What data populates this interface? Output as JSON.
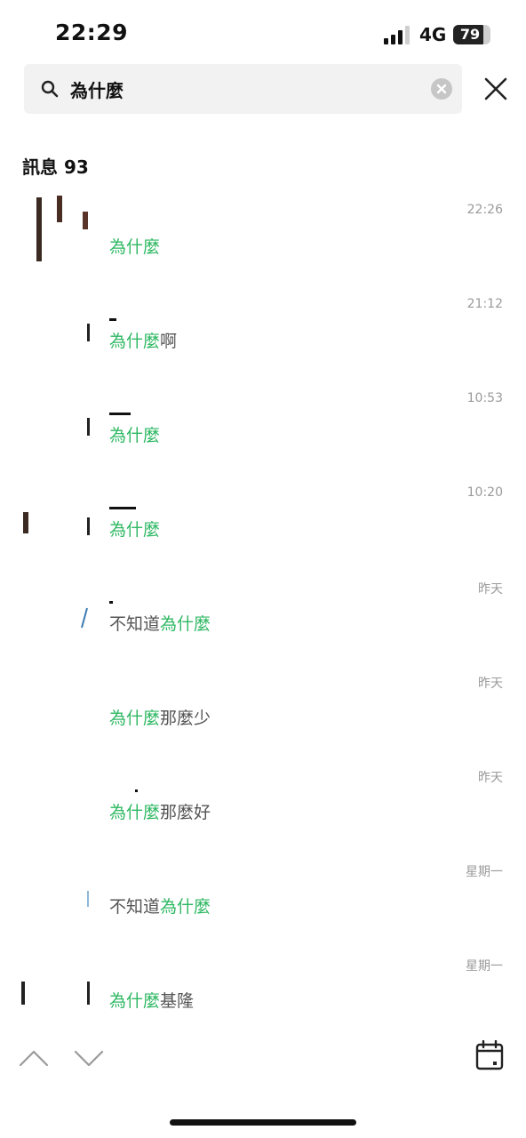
{
  "status_bar": {
    "time": "22:29",
    "network": "4G",
    "battery": "79"
  },
  "search": {
    "query": "為什麼"
  },
  "section": {
    "title": "訊息 93"
  },
  "results": [
    {
      "time": "22:26",
      "before": "",
      "highlight": "為什麼",
      "after": ""
    },
    {
      "time": "21:12",
      "before": "",
      "highlight": "為什麼",
      "after": "啊"
    },
    {
      "time": "10:53",
      "before": "",
      "highlight": "為什麼",
      "after": ""
    },
    {
      "time": "10:20",
      "before": "",
      "highlight": "為什麼",
      "after": ""
    },
    {
      "time": "昨天",
      "before": "不知道",
      "highlight": "為什麼",
      "after": ""
    },
    {
      "time": "昨天",
      "before": "",
      "highlight": "為什麼",
      "after": "那麼少"
    },
    {
      "time": "昨天",
      "before": "",
      "highlight": "為什麼",
      "after": "那麼好"
    },
    {
      "time": "星期一",
      "before": "不知道",
      "highlight": "為什麼",
      "after": ""
    },
    {
      "time": "星期一",
      "before": "",
      "highlight": "為什麼",
      "after": "基隆"
    }
  ],
  "colors": {
    "highlight": "#2fb863",
    "search_bg": "#f2f2f2",
    "muted_text": "#9a9a9a"
  },
  "icons": {
    "search": "search-icon",
    "clear": "clear-icon",
    "close": "close-icon",
    "previous": "chevron-up-icon",
    "next": "chevron-down-icon",
    "calendar": "calendar-icon"
  }
}
